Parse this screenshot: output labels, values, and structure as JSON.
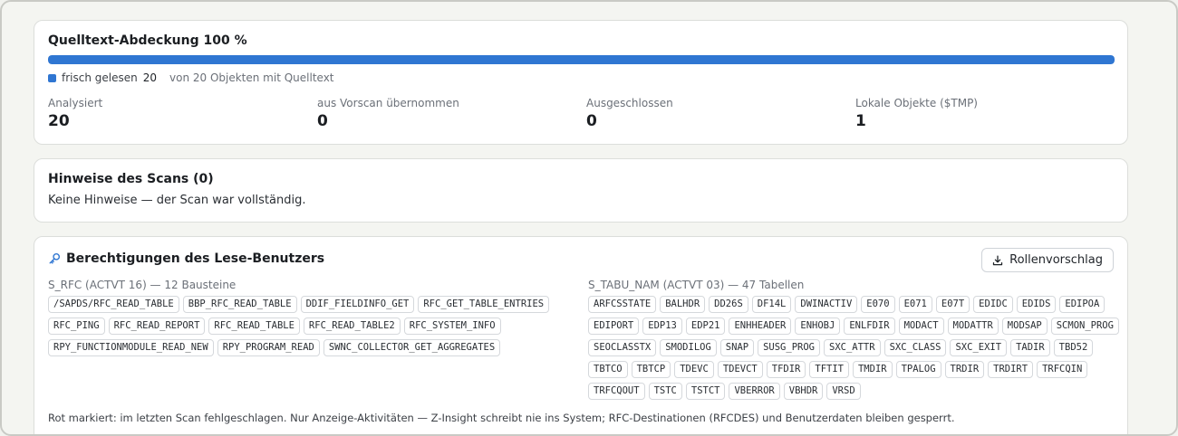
{
  "coverage": {
    "title": "Quelltext-Abdeckung 100 %",
    "progress_percent": 100,
    "legend_label": "frisch gelesen",
    "legend_count": "20",
    "legend_note": "von 20 Objekten mit Quelltext",
    "accent_color": "#2f76d2",
    "stats": [
      {
        "label": "Analysiert",
        "value": "20"
      },
      {
        "label": "aus Vorscan übernommen",
        "value": "0"
      },
      {
        "label": "Ausgeschlossen",
        "value": "0"
      },
      {
        "label": "Lokale Objekte ($TMP)",
        "value": "1"
      }
    ]
  },
  "hints": {
    "title": "Hinweise des Scans (0)",
    "text": "Keine Hinweise — der Scan war vollständig."
  },
  "permissions": {
    "title": "Berechtigungen des Lese-Benutzers",
    "title_icon": "key-icon",
    "role_button_label": "Rollenvorschlag",
    "role_button_icon": "download-icon",
    "rfc": {
      "heading": "S_RFC (ACTVT 16) — 12 Bausteine",
      "items": [
        "/SAPDS/RFC_READ_TABLE",
        "BBP_RFC_READ_TABLE",
        "DDIF_FIELDINFO_GET",
        "RFC_GET_TABLE_ENTRIES",
        "RFC_PING",
        "RFC_READ_REPORT",
        "RFC_READ_TABLE",
        "RFC_READ_TABLE2",
        "RFC_SYSTEM_INFO",
        "RPY_FUNCTIONMODULE_READ_NEW",
        "RPY_PROGRAM_READ",
        "SWNC_COLLECTOR_GET_AGGREGATES"
      ]
    },
    "tabu": {
      "heading": "S_TABU_NAM (ACTVT 03) — 47 Tabellen",
      "items": [
        "ARFCSSTATE",
        "BALHDR",
        "DD26S",
        "DF14L",
        "DWINACTIV",
        "E070",
        "E071",
        "E07T",
        "EDIDC",
        "EDIDS",
        "EDIPOA",
        "EDIPORT",
        "EDP13",
        "EDP21",
        "ENHHEADER",
        "ENHOBJ",
        "ENLFDIR",
        "MODACT",
        "MODATTR",
        "MODSAP",
        "SCMON_PROG",
        "SEOCLASSTX",
        "SMODILOG",
        "SNAP",
        "SUSG_PROG",
        "SXC_ATTR",
        "SXC_CLASS",
        "SXC_EXIT",
        "TADIR",
        "TBD52",
        "TBTCO",
        "TBTCP",
        "TDEVC",
        "TDEVCT",
        "TFDIR",
        "TFTIT",
        "TMDIR",
        "TPALOG",
        "TRDIR",
        "TRDIRT",
        "TRFCQIN",
        "TRFCQOUT",
        "TSTC",
        "TSTCT",
        "VBERROR",
        "VBHDR",
        "VRSD"
      ]
    },
    "footnote": "Rot markiert: im letzten Scan fehlgeschlagen. Nur Anzeige-Aktivitäten — Z-Insight schreibt nie ins System; RFC-Destinationen (RFCDES) und Benutzerdaten bleiben gesperrt."
  }
}
